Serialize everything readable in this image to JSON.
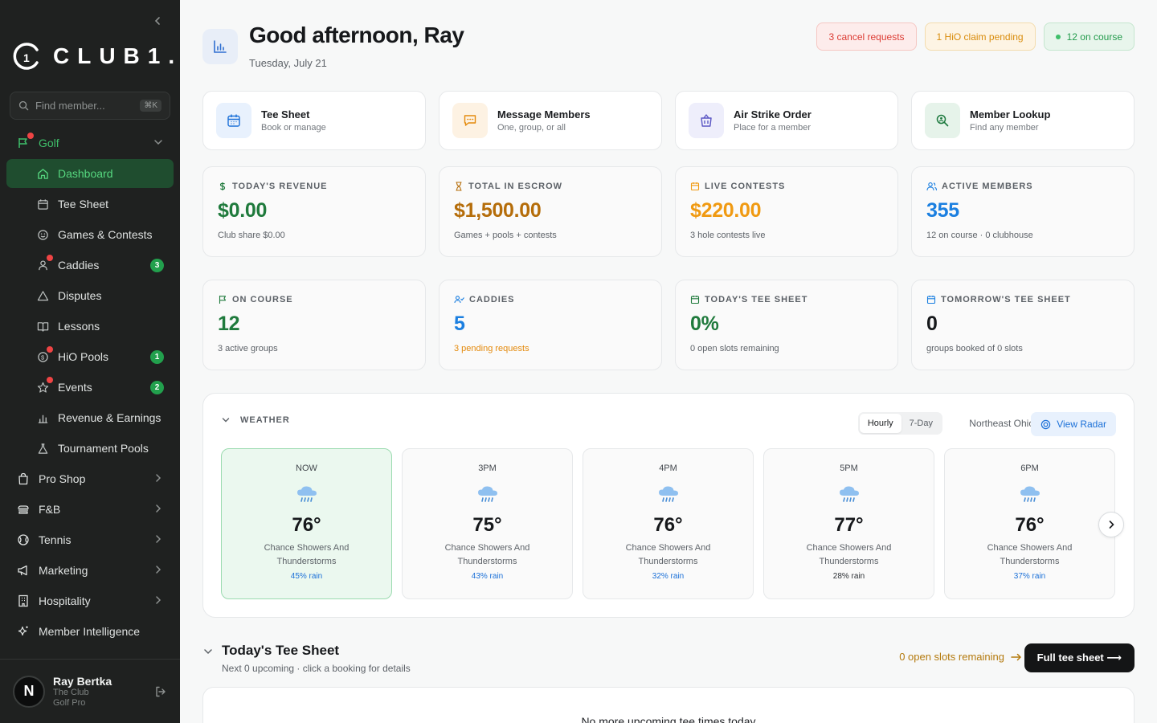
{
  "sidebar": {
    "logo_text": "CLUB1.",
    "search": {
      "placeholder": "Find member...",
      "shortcut": "⌘K"
    },
    "items": [
      {
        "label": "Golf"
      },
      {
        "label": "Dashboard"
      },
      {
        "label": "Tee Sheet"
      },
      {
        "label": "Games & Contests"
      },
      {
        "label": "Caddies",
        "count": "3"
      },
      {
        "label": "Disputes"
      },
      {
        "label": "Lessons"
      },
      {
        "label": "HiO Pools",
        "count": "1"
      },
      {
        "label": "Events",
        "count": "2"
      },
      {
        "label": "Revenue & Earnings"
      },
      {
        "label": "Tournament Pools"
      },
      {
        "label": "Pro Shop"
      },
      {
        "label": "F&B"
      },
      {
        "label": "Tennis"
      },
      {
        "label": "Marketing"
      },
      {
        "label": "Hospitality"
      },
      {
        "label": "Member Intelligence"
      }
    ],
    "user": {
      "initial": "N",
      "name": "Ray Bertka",
      "club": "The Club",
      "role": "Golf Pro"
    }
  },
  "header": {
    "greeting": "Good afternoon, Ray",
    "date": "Tuesday, July 21",
    "pills": {
      "cancel": "3 cancel requests",
      "hio": "1 HiO claim pending",
      "course": "12 on course"
    }
  },
  "quick_actions": [
    {
      "title": "Tee Sheet",
      "sub": "Book or manage"
    },
    {
      "title": "Message Members",
      "sub": "One, group, or all"
    },
    {
      "title": "Air Strike Order",
      "sub": "Place for a member"
    },
    {
      "title": "Member Lookup",
      "sub": "Find any member"
    }
  ],
  "stats": [
    {
      "label": "TODAY'S REVENUE",
      "value": "$0.00",
      "sub": "Club share $0.00",
      "color": "#1f7a3c"
    },
    {
      "label": "TOTAL IN ESCROW",
      "value": "$1,500.00",
      "sub": "Games + pools + contests",
      "color": "#b56d0a"
    },
    {
      "label": "LIVE CONTESTS",
      "value": "$220.00",
      "sub": "3 hole contests live",
      "color": "#f09a12"
    },
    {
      "label": "ACTIVE MEMBERS",
      "value": "355",
      "sub": "12 on course · 0 clubhouse",
      "color": "#1b7fe0"
    },
    {
      "label": "ON COURSE",
      "value": "12",
      "sub": "3 active groups",
      "color": "#1f7a3c"
    },
    {
      "label": "CADDIES",
      "value": "5",
      "sub": "3 pending requests",
      "color": "#1b7fe0"
    },
    {
      "label": "TODAY'S TEE SHEET",
      "value": "0%",
      "sub": "0 open slots remaining",
      "color": "#1f7a3c"
    },
    {
      "label": "TOMORROW'S TEE SHEET",
      "value": "0",
      "sub": "groups booked of 0 slots",
      "color": "#16181b"
    }
  ],
  "weather": {
    "title": "WEATHER",
    "tabs": [
      "Hourly",
      "7-Day"
    ],
    "region": "Northeast Ohio",
    "radar_label": "View Radar",
    "hours": [
      {
        "time": "NOW",
        "temp": "76°",
        "desc": "Chance Showers And Thunderstorms",
        "rain": "45% rain"
      },
      {
        "time": "3PM",
        "temp": "75°",
        "desc": "Chance Showers And Thunderstorms",
        "rain": "43% rain"
      },
      {
        "time": "4PM",
        "temp": "76°",
        "desc": "Chance Showers And Thunderstorms",
        "rain": "32% rain"
      },
      {
        "time": "5PM",
        "temp": "77°",
        "desc": "Chance Showers And Thunderstorms",
        "rain": "28% rain"
      },
      {
        "time": "6PM",
        "temp": "76°",
        "desc": "Chance Showers And Thunderstorms",
        "rain": "37% rain"
      }
    ]
  },
  "tee_sheet": {
    "title": "Today's Tee Sheet",
    "sub": "Next 0 upcoming · click a booking for details",
    "open_slots": "0 open slots remaining",
    "button": "Full tee sheet ⟶",
    "empty": "No more upcoming tee times today"
  }
}
